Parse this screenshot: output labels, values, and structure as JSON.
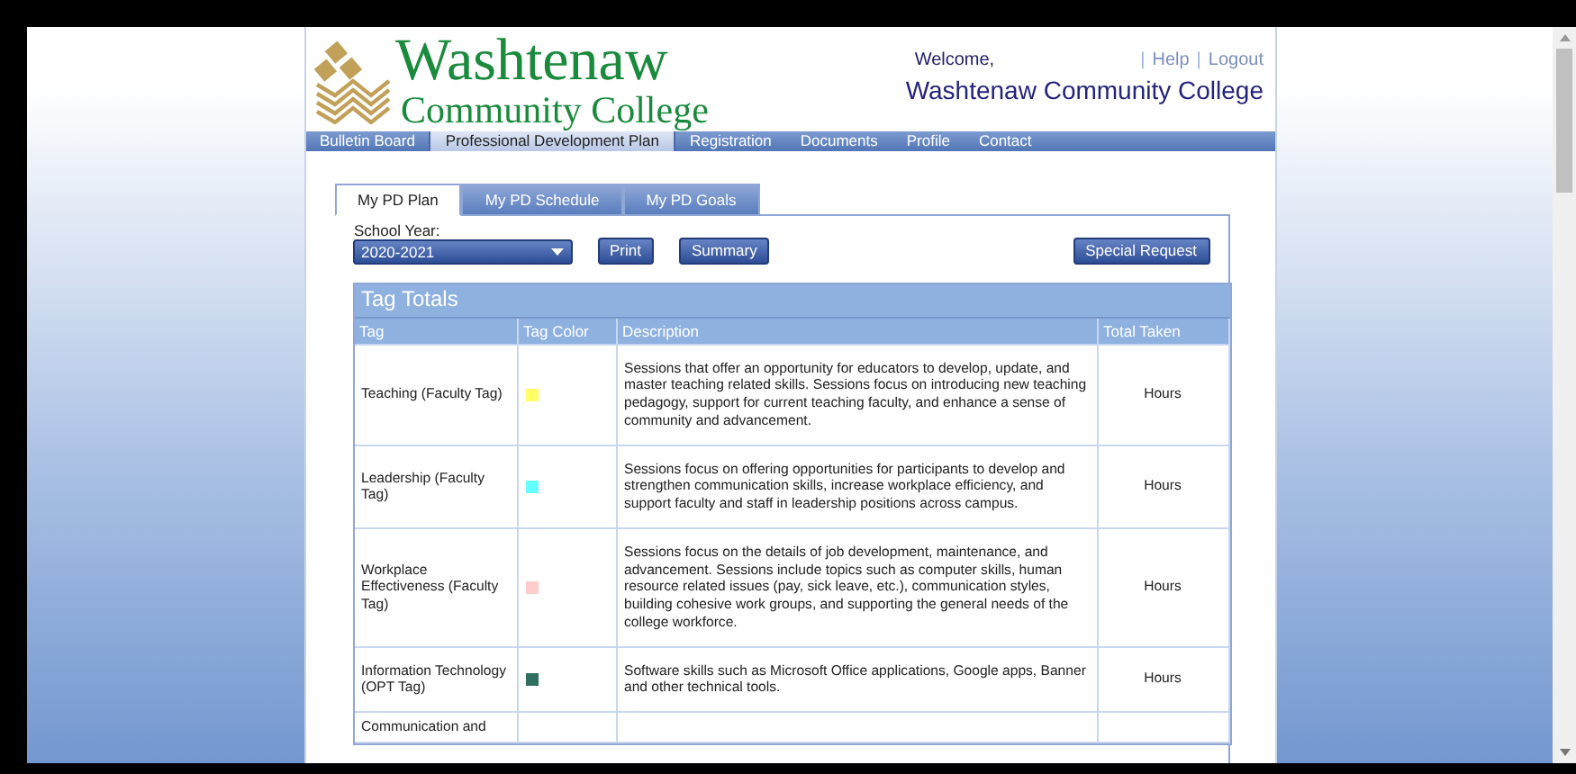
{
  "logo": {
    "line1": "Washtenaw",
    "line2": "Community College"
  },
  "welcome": {
    "greeting": "Welcome,",
    "name": "Washtenaw Community College"
  },
  "top_links": [
    {
      "label": "|",
      "kind": "sep"
    },
    {
      "label": "Help",
      "kind": "link"
    },
    {
      "label": "|",
      "kind": "sep"
    },
    {
      "label": "Logout",
      "kind": "link"
    }
  ],
  "nav": [
    {
      "label": "Bulletin Board",
      "selected": false
    },
    {
      "label": "Professional Development Plan",
      "selected": true
    },
    {
      "label": "Registration",
      "selected": false
    },
    {
      "label": "Documents",
      "selected": false
    },
    {
      "label": "Profile",
      "selected": false
    },
    {
      "label": "Contact",
      "selected": false
    }
  ],
  "tabs": [
    {
      "label": "My PD Plan",
      "selected": true
    },
    {
      "label": "My PD Schedule",
      "selected": false
    },
    {
      "label": "My PD Goals",
      "selected": false
    }
  ],
  "school_year": {
    "label": "School Year:",
    "value": "2020-2021"
  },
  "buttons": [
    "Print",
    "Summary"
  ],
  "special_button": "Special Request",
  "table": {
    "title": "Tag Totals",
    "columns": [
      "Tag",
      "Tag Color",
      "Description",
      "Total Taken"
    ],
    "rows": [
      {
        "tag": "Teaching (Faculty Tag)",
        "color": "#ffff66",
        "description": "Sessions that offer an opportunity for educators to develop, update, and master teaching related skills. Sessions focus on introducing new teaching pedagogy, support for current teaching faculty, and enhance a sense of community and advancement.",
        "total": "Hours"
      },
      {
        "tag": "Leadership (Faculty Tag)",
        "color": "#66ffff",
        "description": "Sessions focus on offering opportunities for participants to develop and strengthen communication skills, increase workplace efficiency, and support faculty and staff in leadership positions across campus.",
        "total": "Hours"
      },
      {
        "tag": "Workplace Effectiveness (Faculty Tag)",
        "color": "#ffcccc",
        "description": "Sessions focus on the details of job development, maintenance, and advancement.  Sessions include topics such as computer skills, human resource related issues (pay, sick leave, etc.), communication styles, building cohesive work groups, and supporting the general needs of the college workforce.",
        "total": "Hours"
      },
      {
        "tag": "Information Technology (OPT Tag)",
        "color": "#2f6f60",
        "description": "Software skills such as Microsoft Office applications, Google apps, Banner and other technical tools.",
        "total": "Hours"
      },
      {
        "tag": "Communication and"
      }
    ]
  }
}
